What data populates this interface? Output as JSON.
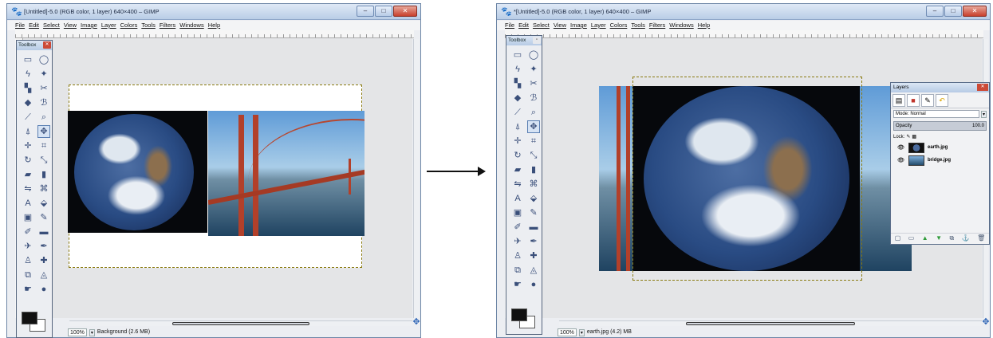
{
  "left_window": {
    "title": "[Untitled]-5.0 (RGB color, 1 layer) 640×400 – GIMP",
    "zoom": "100%",
    "status": "Background (2.6 MB)"
  },
  "right_window": {
    "title": "*[Untitled]-5.0 (RGB color, 1 layer) 640×400 – GIMP",
    "zoom": "100%",
    "status": "earth.jpg (4.2) MB"
  },
  "menu": [
    "File",
    "Edit",
    "Select",
    "View",
    "Image",
    "Layer",
    "Colors",
    "Tools",
    "Filters",
    "Windows",
    "Help"
  ],
  "toolbox": {
    "title": "Toolbox"
  },
  "tools": [
    {
      "name": "rect-select-icon",
      "glyph": "▭"
    },
    {
      "name": "ellipse-select-icon",
      "glyph": "◯"
    },
    {
      "name": "lasso-icon",
      "glyph": "ϟ"
    },
    {
      "name": "fuzzy-select-icon",
      "glyph": "✦"
    },
    {
      "name": "color-select-icon",
      "glyph": "▚"
    },
    {
      "name": "scissors-icon",
      "glyph": "✂"
    },
    {
      "name": "foreground-select-icon",
      "glyph": "◆"
    },
    {
      "name": "paths-icon",
      "glyph": "ℬ"
    },
    {
      "name": "color-picker-icon",
      "glyph": "⟋"
    },
    {
      "name": "zoom-icon",
      "glyph": "⌕"
    },
    {
      "name": "measure-icon",
      "glyph": "⍋"
    },
    {
      "name": "move-icon",
      "glyph": "✥"
    },
    {
      "name": "align-icon",
      "glyph": "✛"
    },
    {
      "name": "crop-icon",
      "glyph": "⌗"
    },
    {
      "name": "rotate-icon",
      "glyph": "↻"
    },
    {
      "name": "scale-icon",
      "glyph": "⤡"
    },
    {
      "name": "shear-icon",
      "glyph": "▰"
    },
    {
      "name": "perspective-icon",
      "glyph": "▮"
    },
    {
      "name": "flip-icon",
      "glyph": "⇋"
    },
    {
      "name": "cage-icon",
      "glyph": "⌘"
    },
    {
      "name": "text-icon",
      "glyph": "A"
    },
    {
      "name": "bucket-fill-icon",
      "glyph": "⬙"
    },
    {
      "name": "blend-icon",
      "glyph": "▣"
    },
    {
      "name": "pencil-icon",
      "glyph": "✎"
    },
    {
      "name": "paintbrush-icon",
      "glyph": "✐"
    },
    {
      "name": "eraser-icon",
      "glyph": "▬"
    },
    {
      "name": "airbrush-icon",
      "glyph": "✈"
    },
    {
      "name": "ink-icon",
      "glyph": "✒"
    },
    {
      "name": "clone-icon",
      "glyph": "♙"
    },
    {
      "name": "heal-icon",
      "glyph": "✚"
    },
    {
      "name": "perspective-clone-icon",
      "glyph": "⧉"
    },
    {
      "name": "blur-icon",
      "glyph": "◬"
    },
    {
      "name": "smudge-icon",
      "glyph": "☛"
    },
    {
      "name": "dodge-burn-icon",
      "glyph": "●"
    }
  ],
  "layers_dialog": {
    "title": "Layers",
    "mode_label": "Mode: Normal",
    "opacity_label": "Opacity",
    "opacity_value": "100.0",
    "lock_label": "Lock:",
    "layers": [
      {
        "name": "earth.jpg"
      },
      {
        "name": "bridge.jpg"
      }
    ]
  }
}
